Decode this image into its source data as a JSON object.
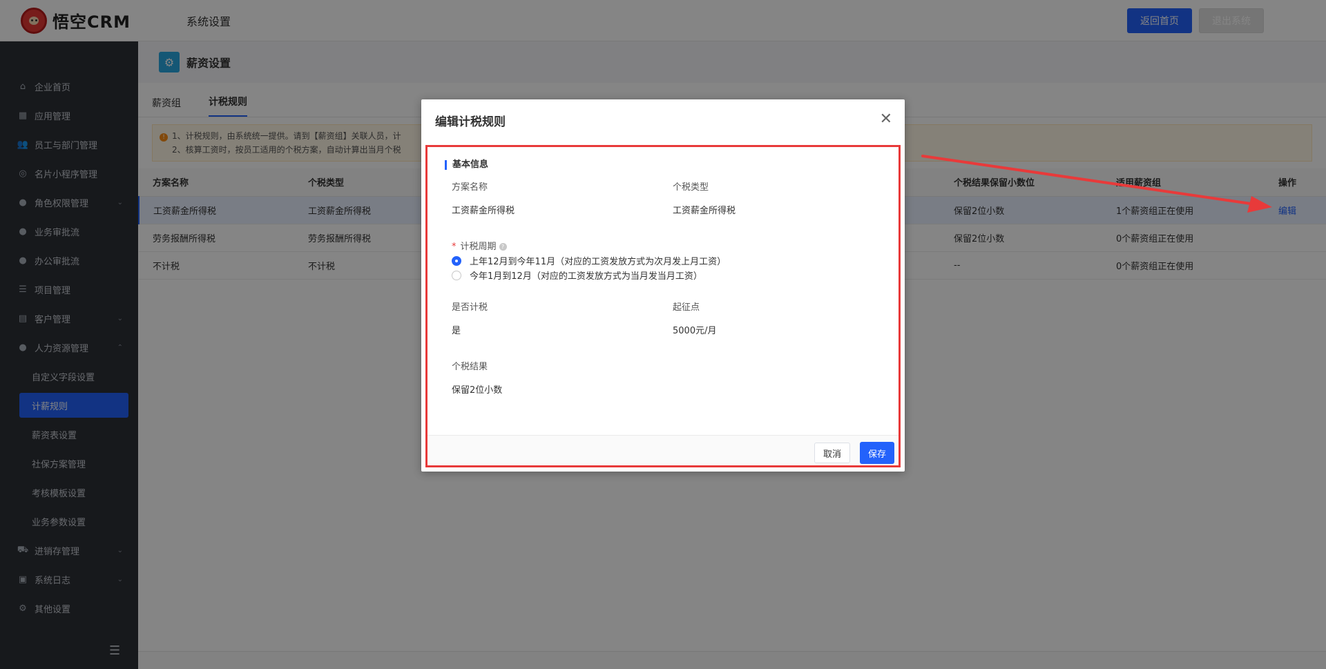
{
  "header": {
    "logo_text": "悟空CRM",
    "title": "系统设置",
    "home_button": "返回首页",
    "logout_button": "退出系统"
  },
  "sidebar": {
    "items": [
      {
        "label": "企业首页",
        "icon": "home-icon"
      },
      {
        "label": "应用管理",
        "icon": "grid-icon"
      },
      {
        "label": "员工与部门管理",
        "icon": "users-icon"
      },
      {
        "label": "名片小程序管理",
        "icon": "card-icon"
      },
      {
        "label": "角色权限管理",
        "icon": "user-icon",
        "expandable": true
      },
      {
        "label": "业务审批流",
        "icon": "user-icon"
      },
      {
        "label": "办公审批流",
        "icon": "user-icon"
      },
      {
        "label": "项目管理",
        "icon": "list-icon"
      },
      {
        "label": "客户管理",
        "icon": "customer-icon",
        "expandable": true
      },
      {
        "label": "人力资源管理",
        "icon": "hr-icon",
        "expanded": true
      }
    ],
    "hr_sub_items": [
      "自定义字段设置",
      "计薪规则",
      "薪资表设置",
      "社保方案管理",
      "考核模板设置",
      "业务参数设置"
    ],
    "hr_active": "计薪规则",
    "bottom_items": [
      {
        "label": "进销存管理",
        "icon": "truck-icon",
        "expandable": true
      },
      {
        "label": "系统日志",
        "icon": "log-icon",
        "expandable": true
      },
      {
        "label": "其他设置",
        "icon": "gear-icon"
      }
    ]
  },
  "main": {
    "page_title": "薪资设置",
    "tabs": [
      "薪资组",
      "计税规则"
    ],
    "active_tab": "计税规则",
    "notice": {
      "line1": "1、计税规则，由系统统一提供。请到【薪资组】关联人员，计",
      "line2": "2、核算工资时，按员工适用的个税方案，自动计算出当月个税"
    },
    "table": {
      "columns": [
        "方案名称",
        "个税类型",
        "个税结果保留小数位",
        "适用薪资组",
        "操作"
      ],
      "rows": [
        {
          "name": "工资薪金所得税",
          "type": "工资薪金所得税",
          "decimals": "保留2位小数",
          "groups": "1个薪资组正在使用",
          "action": "编辑"
        },
        {
          "name": "劳务报酬所得税",
          "type": "劳务报酬所得税",
          "decimals": "保留2位小数",
          "groups": "0个薪资组正在使用",
          "action": ""
        },
        {
          "name": "不计税",
          "type": "不计税",
          "decimals": "--",
          "groups": "0个薪资组正在使用",
          "action": ""
        }
      ]
    }
  },
  "dialog": {
    "title": "编辑计税规则",
    "section_title": "基本信息",
    "plan_name_label": "方案名称",
    "plan_name_value": "工资薪金所得税",
    "tax_type_label": "个税类型",
    "tax_type_value": "工资薪金所得税",
    "period_label": "计税周期",
    "period_options": [
      {
        "label": "上年12月到今年11月（对应的工资发放方式为次月发上月工资）",
        "checked": true
      },
      {
        "label": "今年1月到12月（对应的工资发放方式为当月发当月工资）",
        "checked": false
      }
    ],
    "is_tax_label": "是否计税",
    "is_tax_value": "是",
    "threshold_label": "起征点",
    "threshold_value": "5000元/月",
    "result_label": "个税结果",
    "result_value": "保留2位小数",
    "cancel_button": "取消",
    "save_button": "保存"
  },
  "colors": {
    "primary": "#2362fb",
    "highlight": "#e83a3a",
    "sidebar_bg": "#2d3037"
  }
}
